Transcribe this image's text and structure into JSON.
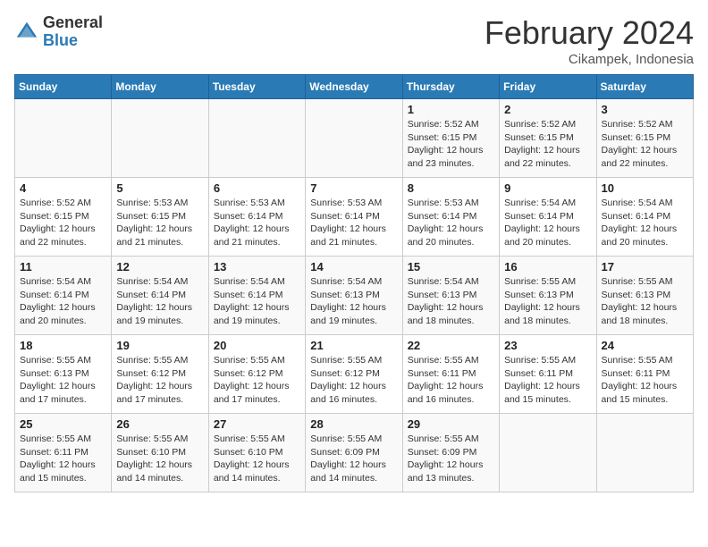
{
  "header": {
    "logo_general": "General",
    "logo_blue": "Blue",
    "title": "February 2024",
    "location": "Cikampek, Indonesia"
  },
  "calendar": {
    "days_of_week": [
      "Sunday",
      "Monday",
      "Tuesday",
      "Wednesday",
      "Thursday",
      "Friday",
      "Saturday"
    ],
    "weeks": [
      [
        {
          "day": "",
          "info": ""
        },
        {
          "day": "",
          "info": ""
        },
        {
          "day": "",
          "info": ""
        },
        {
          "day": "",
          "info": ""
        },
        {
          "day": "1",
          "info": "Sunrise: 5:52 AM\nSunset: 6:15 PM\nDaylight: 12 hours\nand 23 minutes."
        },
        {
          "day": "2",
          "info": "Sunrise: 5:52 AM\nSunset: 6:15 PM\nDaylight: 12 hours\nand 22 minutes."
        },
        {
          "day": "3",
          "info": "Sunrise: 5:52 AM\nSunset: 6:15 PM\nDaylight: 12 hours\nand 22 minutes."
        }
      ],
      [
        {
          "day": "4",
          "info": "Sunrise: 5:52 AM\nSunset: 6:15 PM\nDaylight: 12 hours\nand 22 minutes."
        },
        {
          "day": "5",
          "info": "Sunrise: 5:53 AM\nSunset: 6:15 PM\nDaylight: 12 hours\nand 21 minutes."
        },
        {
          "day": "6",
          "info": "Sunrise: 5:53 AM\nSunset: 6:14 PM\nDaylight: 12 hours\nand 21 minutes."
        },
        {
          "day": "7",
          "info": "Sunrise: 5:53 AM\nSunset: 6:14 PM\nDaylight: 12 hours\nand 21 minutes."
        },
        {
          "day": "8",
          "info": "Sunrise: 5:53 AM\nSunset: 6:14 PM\nDaylight: 12 hours\nand 20 minutes."
        },
        {
          "day": "9",
          "info": "Sunrise: 5:54 AM\nSunset: 6:14 PM\nDaylight: 12 hours\nand 20 minutes."
        },
        {
          "day": "10",
          "info": "Sunrise: 5:54 AM\nSunset: 6:14 PM\nDaylight: 12 hours\nand 20 minutes."
        }
      ],
      [
        {
          "day": "11",
          "info": "Sunrise: 5:54 AM\nSunset: 6:14 PM\nDaylight: 12 hours\nand 20 minutes."
        },
        {
          "day": "12",
          "info": "Sunrise: 5:54 AM\nSunset: 6:14 PM\nDaylight: 12 hours\nand 19 minutes."
        },
        {
          "day": "13",
          "info": "Sunrise: 5:54 AM\nSunset: 6:14 PM\nDaylight: 12 hours\nand 19 minutes."
        },
        {
          "day": "14",
          "info": "Sunrise: 5:54 AM\nSunset: 6:13 PM\nDaylight: 12 hours\nand 19 minutes."
        },
        {
          "day": "15",
          "info": "Sunrise: 5:54 AM\nSunset: 6:13 PM\nDaylight: 12 hours\nand 18 minutes."
        },
        {
          "day": "16",
          "info": "Sunrise: 5:55 AM\nSunset: 6:13 PM\nDaylight: 12 hours\nand 18 minutes."
        },
        {
          "day": "17",
          "info": "Sunrise: 5:55 AM\nSunset: 6:13 PM\nDaylight: 12 hours\nand 18 minutes."
        }
      ],
      [
        {
          "day": "18",
          "info": "Sunrise: 5:55 AM\nSunset: 6:13 PM\nDaylight: 12 hours\nand 17 minutes."
        },
        {
          "day": "19",
          "info": "Sunrise: 5:55 AM\nSunset: 6:12 PM\nDaylight: 12 hours\nand 17 minutes."
        },
        {
          "day": "20",
          "info": "Sunrise: 5:55 AM\nSunset: 6:12 PM\nDaylight: 12 hours\nand 17 minutes."
        },
        {
          "day": "21",
          "info": "Sunrise: 5:55 AM\nSunset: 6:12 PM\nDaylight: 12 hours\nand 16 minutes."
        },
        {
          "day": "22",
          "info": "Sunrise: 5:55 AM\nSunset: 6:11 PM\nDaylight: 12 hours\nand 16 minutes."
        },
        {
          "day": "23",
          "info": "Sunrise: 5:55 AM\nSunset: 6:11 PM\nDaylight: 12 hours\nand 15 minutes."
        },
        {
          "day": "24",
          "info": "Sunrise: 5:55 AM\nSunset: 6:11 PM\nDaylight: 12 hours\nand 15 minutes."
        }
      ],
      [
        {
          "day": "25",
          "info": "Sunrise: 5:55 AM\nSunset: 6:11 PM\nDaylight: 12 hours\nand 15 minutes."
        },
        {
          "day": "26",
          "info": "Sunrise: 5:55 AM\nSunset: 6:10 PM\nDaylight: 12 hours\nand 14 minutes."
        },
        {
          "day": "27",
          "info": "Sunrise: 5:55 AM\nSunset: 6:10 PM\nDaylight: 12 hours\nand 14 minutes."
        },
        {
          "day": "28",
          "info": "Sunrise: 5:55 AM\nSunset: 6:09 PM\nDaylight: 12 hours\nand 14 minutes."
        },
        {
          "day": "29",
          "info": "Sunrise: 5:55 AM\nSunset: 6:09 PM\nDaylight: 12 hours\nand 13 minutes."
        },
        {
          "day": "",
          "info": ""
        },
        {
          "day": "",
          "info": ""
        }
      ]
    ]
  }
}
